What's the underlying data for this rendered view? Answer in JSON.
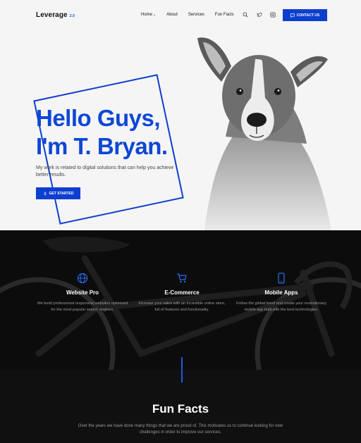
{
  "nav": {
    "logo": "Leverage",
    "logo_version": "2.0",
    "items": [
      {
        "label": "Home"
      },
      {
        "label": "About"
      },
      {
        "label": "Services"
      },
      {
        "label": "Fun Facts"
      }
    ],
    "icons": [
      "search-icon",
      "twitter-icon",
      "instagram-icon"
    ],
    "contact_label": "CONTACT US"
  },
  "hero": {
    "title_line1": "Hello Guys,",
    "title_line2": "I'm T. Bryan.",
    "text": "My work is related to digital solutions that can help you achieve better results.",
    "cta_label": "GET STARTED"
  },
  "services": [
    {
      "icon": "globe-icon",
      "title": "Website Pro",
      "text": "We build professional responsive websites optimized for the most popular search engines."
    },
    {
      "icon": "cart-icon",
      "title": "E-Commerce",
      "text": "Increase your sales with an incredible online store, full of features and functionality."
    },
    {
      "icon": "mobile-icon",
      "title": "Mobile Apps",
      "text": "Follow the global trend and create your revolutionary mobile app built with the best technologies."
    }
  ],
  "facts": {
    "title": "Fun Facts",
    "text": "Over the years we have done many things that we are proud of. This motivates us to continue looking for new challenges in order to improve our services."
  },
  "colors": {
    "accent": "#0d3fcf",
    "title_blue": "#0d47d6",
    "dark_bg": "#0c0c0c"
  }
}
